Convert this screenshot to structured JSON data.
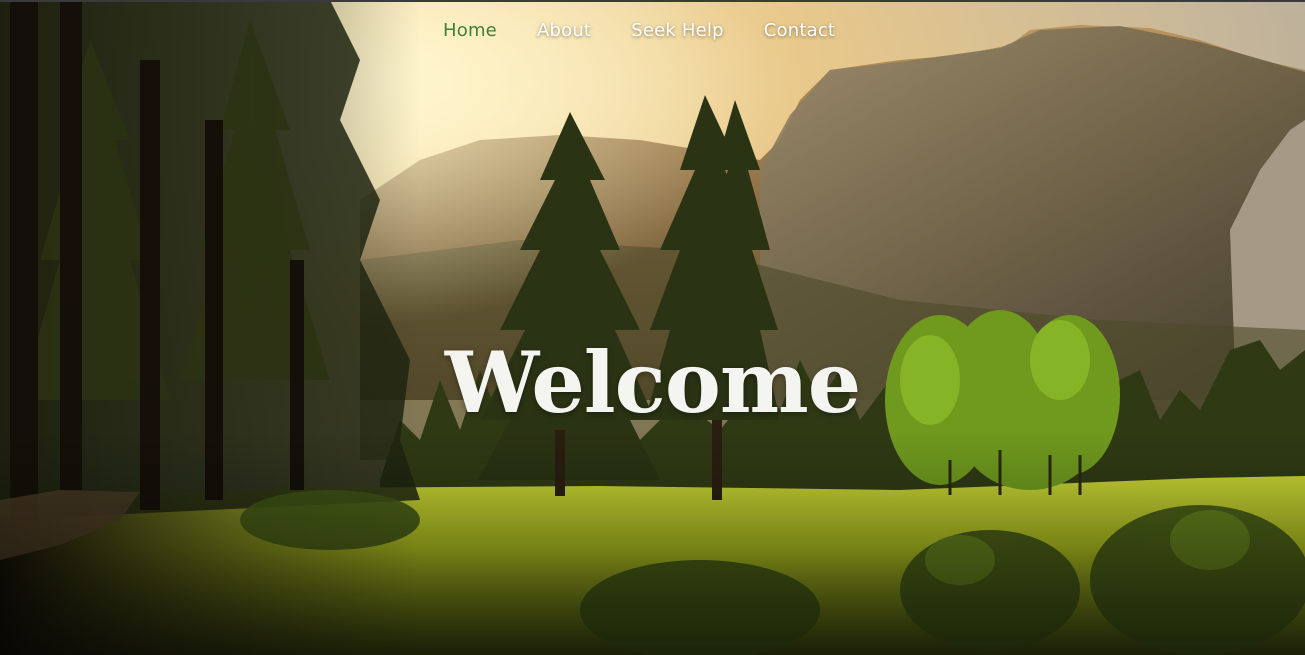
{
  "nav": {
    "items": [
      {
        "label": "Home",
        "active": true
      },
      {
        "label": "About",
        "active": false
      },
      {
        "label": "Seek Help",
        "active": false
      },
      {
        "label": "Contact",
        "active": false
      }
    ]
  },
  "hero": {
    "heading": "Welcome",
    "background": "forest-valley-photo"
  },
  "colors": {
    "active_link": "#3f7f36",
    "link": "#ffffff"
  }
}
